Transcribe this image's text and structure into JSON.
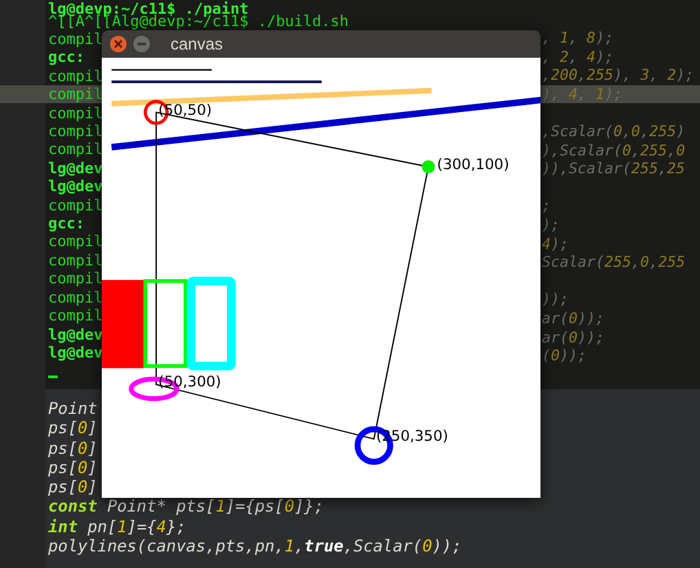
{
  "terminal": {
    "lines": [
      {
        "text": "lg@devp:~/c11$ ./paint",
        "bold": true
      },
      {
        "text": "^[[A^[[Alg@devp:~/c11$ ./build.sh",
        "bold": false
      },
      {
        "text": "compil",
        "bold": false
      },
      {
        "text": "gcc:",
        "bold": true
      },
      {
        "text": "compil",
        "bold": false
      },
      {
        "text": "compil",
        "bold": false
      },
      {
        "text": "compil",
        "bold": false
      },
      {
        "text": "compil",
        "bold": false
      },
      {
        "text": "compil",
        "bold": false
      },
      {
        "text": "lg@dev",
        "bold": true
      },
      {
        "text": "lg@dev",
        "bold": true
      },
      {
        "text": "compil",
        "bold": false
      },
      {
        "text": "gcc:",
        "bold": true
      },
      {
        "text": "compil",
        "bold": false
      },
      {
        "text": "compil",
        "bold": false
      },
      {
        "text": "compil",
        "bold": false
      },
      {
        "text": "compil",
        "bold": false
      },
      {
        "text": "compil",
        "bold": false
      },
      {
        "text": "lg@dev",
        "bold": true
      },
      {
        "text": "lg@dev",
        "bold": true
      }
    ]
  },
  "editor": {
    "background_lines": [
      {
        "kind": "code",
        "current": false,
        "segments": [
          {
            "kind": "plain",
            "text": ", "
          },
          {
            "kind": "number",
            "text": "1"
          },
          {
            "kind": "plain",
            "text": ", "
          },
          {
            "kind": "number",
            "text": "8"
          },
          {
            "kind": "plain",
            "text": ");"
          }
        ]
      },
      {
        "kind": "code",
        "current": false,
        "segments": [
          {
            "kind": "plain",
            "text": ", "
          },
          {
            "kind": "number",
            "text": "2"
          },
          {
            "kind": "plain",
            "text": ", "
          },
          {
            "kind": "number",
            "text": "4"
          },
          {
            "kind": "plain",
            "text": ");"
          }
        ]
      },
      {
        "kind": "code",
        "current": false,
        "segments": [
          {
            "kind": "plain",
            "text": ","
          },
          {
            "kind": "number",
            "text": "200"
          },
          {
            "kind": "plain",
            "text": ","
          },
          {
            "kind": "number",
            "text": "255"
          },
          {
            "kind": "plain",
            "text": "), "
          },
          {
            "kind": "number",
            "text": "3"
          },
          {
            "kind": "plain",
            "text": ", "
          },
          {
            "kind": "number",
            "text": "2"
          },
          {
            "kind": "plain",
            "text": ");"
          }
        ]
      },
      {
        "kind": "code",
        "current": true,
        "segments": [
          {
            "kind": "plain",
            "text": "), "
          },
          {
            "kind": "number",
            "text": "4"
          },
          {
            "kind": "plain",
            "text": ", "
          },
          {
            "kind": "number",
            "text": "1"
          },
          {
            "kind": "plain",
            "text": ");"
          }
        ]
      },
      {
        "kind": "blank",
        "current": false
      },
      {
        "kind": "code",
        "current": false,
        "segments": [
          {
            "kind": "plain",
            "text": ",Scalar("
          },
          {
            "kind": "number",
            "text": "0"
          },
          {
            "kind": "plain",
            "text": ","
          },
          {
            "kind": "number",
            "text": "0"
          },
          {
            "kind": "plain",
            "text": ","
          },
          {
            "kind": "number",
            "text": "255"
          },
          {
            "kind": "plain",
            "text": ")"
          }
        ]
      },
      {
        "kind": "code",
        "current": false,
        "segments": [
          {
            "kind": "plain",
            "text": "),Scalar("
          },
          {
            "kind": "number",
            "text": "0"
          },
          {
            "kind": "plain",
            "text": ","
          },
          {
            "kind": "number",
            "text": "255"
          },
          {
            "kind": "plain",
            "text": ","
          },
          {
            "kind": "number",
            "text": "0"
          }
        ]
      },
      {
        "kind": "code",
        "current": false,
        "segments": [
          {
            "kind": "plain",
            "text": ")),Scalar("
          },
          {
            "kind": "number",
            "text": "255"
          },
          {
            "kind": "plain",
            "text": ","
          },
          {
            "kind": "number",
            "text": "25"
          }
        ]
      },
      {
        "kind": "blank",
        "current": false
      },
      {
        "kind": "code",
        "current": false,
        "segments": [
          {
            "kind": "plain",
            "text": ";"
          }
        ]
      },
      {
        "kind": "code",
        "current": false,
        "segments": [
          {
            "kind": "plain",
            "text": ");"
          }
        ]
      },
      {
        "kind": "code",
        "current": false,
        "segments": [
          {
            "kind": "number",
            "text": "4"
          },
          {
            "kind": "plain",
            "text": ");"
          }
        ]
      },
      {
        "kind": "code",
        "current": false,
        "segments": [
          {
            "kind": "plain",
            "text": "Scalar("
          },
          {
            "kind": "number",
            "text": "255"
          },
          {
            "kind": "plain",
            "text": ","
          },
          {
            "kind": "number",
            "text": "0"
          },
          {
            "kind": "plain",
            "text": ","
          },
          {
            "kind": "number",
            "text": "255"
          }
        ]
      },
      {
        "kind": "blank",
        "current": false
      },
      {
        "kind": "code",
        "current": false,
        "segments": [
          {
            "kind": "plain",
            "text": "));"
          }
        ]
      },
      {
        "kind": "code",
        "current": false,
        "segments": [
          {
            "kind": "plain",
            "text": "ar("
          },
          {
            "kind": "number",
            "text": "0"
          },
          {
            "kind": "plain",
            "text": "));"
          }
        ]
      },
      {
        "kind": "code",
        "current": false,
        "segments": [
          {
            "kind": "plain",
            "text": "ar("
          },
          {
            "kind": "number",
            "text": "0"
          },
          {
            "kind": "plain",
            "text": "));"
          }
        ]
      },
      {
        "kind": "code",
        "current": false,
        "segments": [
          {
            "kind": "plain",
            "text": "("
          },
          {
            "kind": "number",
            "text": "0"
          },
          {
            "kind": "plain",
            "text": "));"
          }
        ]
      }
    ],
    "code_lines": [
      {
        "segments": [
          {
            "kind": "plain",
            "text": "Point"
          }
        ]
      },
      {
        "segments": [
          {
            "kind": "plain",
            "text": "ps["
          },
          {
            "kind": "number",
            "text": "0"
          },
          {
            "kind": "plain",
            "text": "]"
          }
        ]
      },
      {
        "segments": [
          {
            "kind": "plain",
            "text": "ps["
          },
          {
            "kind": "number",
            "text": "0"
          },
          {
            "kind": "plain",
            "text": "]"
          }
        ]
      },
      {
        "segments": [
          {
            "kind": "plain",
            "text": "ps["
          },
          {
            "kind": "number",
            "text": "0"
          },
          {
            "kind": "plain",
            "text": "]"
          }
        ]
      },
      {
        "segments": [
          {
            "kind": "plain",
            "text": "ps["
          },
          {
            "kind": "number",
            "text": "0"
          },
          {
            "kind": "plain",
            "text": "]"
          }
        ]
      },
      {
        "segments": [
          {
            "kind": "keyword",
            "text": "const"
          },
          {
            "kind": "plain",
            "text": " Point* pts["
          },
          {
            "kind": "number",
            "text": "1"
          },
          {
            "kind": "plain",
            "text": "]={ps["
          },
          {
            "kind": "number",
            "text": "0"
          },
          {
            "kind": "plain",
            "text": "]};"
          }
        ]
      },
      {
        "segments": [
          {
            "kind": "keyword",
            "text": "int"
          },
          {
            "kind": "plain",
            "text": " pn["
          },
          {
            "kind": "number",
            "text": "1"
          },
          {
            "kind": "plain",
            "text": "]={"
          },
          {
            "kind": "number",
            "text": "4"
          },
          {
            "kind": "plain",
            "text": "};"
          }
        ]
      },
      {
        "segments": [
          {
            "kind": "plain",
            "text": "polylines(canvas,pts,pn,"
          },
          {
            "kind": "number",
            "text": "1"
          },
          {
            "kind": "plain",
            "text": ","
          },
          {
            "kind": "literal",
            "text": "true"
          },
          {
            "kind": "plain",
            "text": ",Scalar("
          },
          {
            "kind": "number",
            "text": "0"
          },
          {
            "kind": "plain",
            "text": "));"
          }
        ]
      }
    ]
  },
  "canvas_window": {
    "title": "canvas",
    "point_labels": [
      "(50,50)",
      "(300,100)",
      "(50,300)",
      "(250,350)"
    ]
  }
}
